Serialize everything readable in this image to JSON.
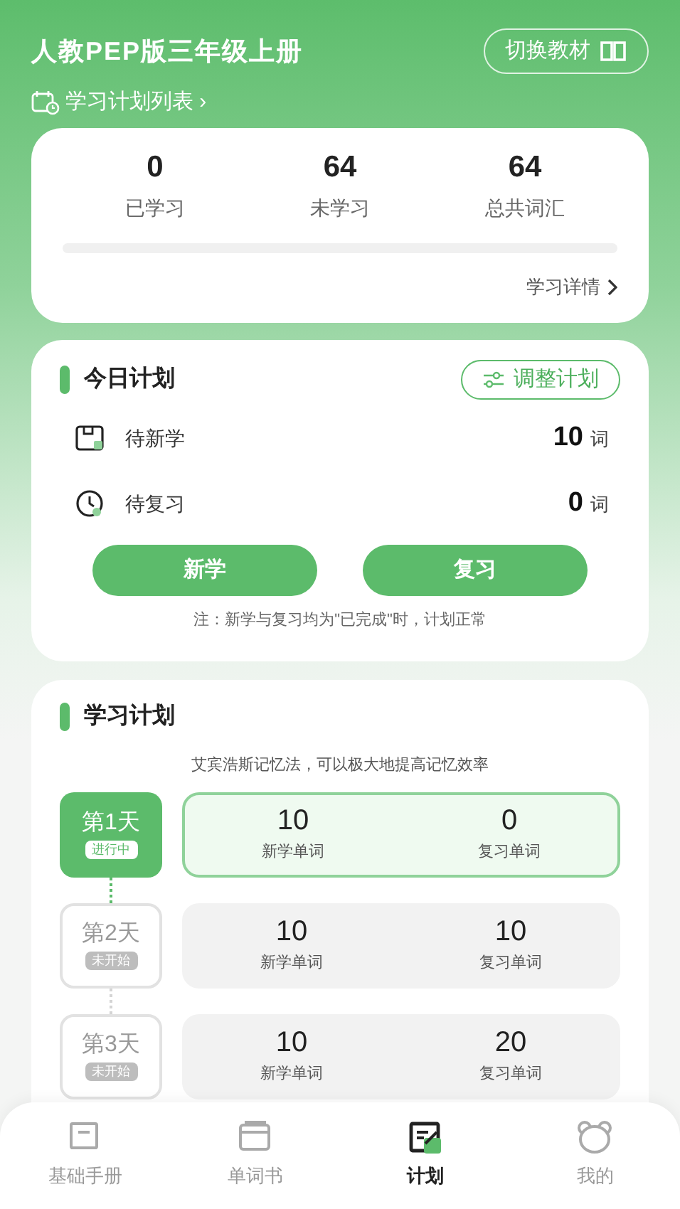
{
  "header": {
    "title": "人教PEP版三年级上册",
    "switch_button": "切换教材",
    "plan_list_link": "学习计划列表 ›"
  },
  "stats": {
    "items": [
      {
        "value": "0",
        "label": "已学习"
      },
      {
        "value": "64",
        "label": "未学习"
      },
      {
        "value": "64",
        "label": "总共词汇"
      }
    ],
    "progress": {
      "level": 0
    },
    "details_link": "学习详情"
  },
  "today_plan": {
    "title": "今日计划",
    "adjust_button": "调整计划",
    "rows": [
      {
        "kind": "new",
        "label": "待新学",
        "count": "10",
        "unit": "词"
      },
      {
        "kind": "review",
        "label": "待复习",
        "count": "0",
        "unit": "词"
      }
    ],
    "buttons": [
      "新学",
      "复习"
    ],
    "note": "注：新学与复习均为\"已完成\"时，计划正常"
  },
  "study_plan": {
    "title": "学习计划",
    "subtitle": "艾宾浩斯记忆法，可以极大地提高记忆效率",
    "days": [
      {
        "day": "第1天",
        "status": "进行中",
        "selected": true,
        "new_count": "10",
        "new_label": "新学单词",
        "review_count": "0",
        "review_label": "复习单词"
      },
      {
        "day": "第2天",
        "status": "未开始",
        "selected": false,
        "new_count": "10",
        "new_label": "新学单词",
        "review_count": "10",
        "review_label": "复习单词"
      },
      {
        "day": "第3天",
        "status": "未开始",
        "selected": false,
        "new_count": "10",
        "new_label": "新学单词",
        "review_count": "20",
        "review_label": "复习单词"
      }
    ]
  },
  "tab_bar": [
    {
      "kind": "handbook",
      "label": "基础手册",
      "selected": false
    },
    {
      "kind": "wordbook",
      "label": "单词书",
      "selected": false
    },
    {
      "kind": "plan",
      "label": "计划",
      "selected": true
    },
    {
      "kind": "profile",
      "label": "我的",
      "selected": false
    }
  ]
}
